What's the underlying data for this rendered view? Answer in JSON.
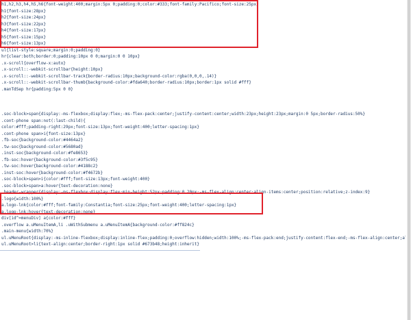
{
  "lines": [
    "h1,h2,h3,h4,h5,h6{font-weight:400;margin:5px 0;padding:0;color:#333;font-family:Pacifico;font-size:25px}",
    "h1{font-size:28px}",
    "h2{font-size:24px}",
    "h3{font-size:22px}",
    "h4{font-size:17px}",
    "h5{font-size:15px}",
    "h6{font-size:13px}",
    "ul{list-style:square;margin:0;padding:0}",
    "hr{clear:both;border:0;padding:10px 0 0;margin:0 0 10px}",
    ".x-scroll{overflow-x:auto}",
    ".x-scroll::-webkit-scrollbar{height:10px}",
    ".x-scroll::-webkit-scrollbar-track{border-radius:10px;background-color:rgba(0,0,0,.14)}",
    ".x-scroll::-webkit-scrollbar-thumb{background-color:#fda640;border-radius:10px;border:1px solid #fff}",
    ".manTdSep hr{padding:5px 0 0}",
    ".soc-block>span{display:-ms-flexbox;display:flex;-ms-flex-pack:center;justify-content:center;width:23px;height:23px;margin:0 5px;border-radius:50%}",
    ".cont-phone span:not(:last-child){",
    "color:#fff;padding-right:29px;font-size:13px;font-weight:400;letter-spacing:1px}",
    ".cont-phone span>i{font-size:13px}",
    ".fb-soc{background-color:#4464a2}",
    ".tw-soc{background-color:#5680ad}",
    ".inst-soc{background-color:#fe8653}",
    ".fb-soc:hover{background-color:#3f5c95}",
    ".tw-soc:hover{background-color:#4188c2}",
    ".inst-soc:hover{background-color:#f4672b}",
    ".soc-block>span>i{color:#fff;font-size:13px;font-weight:400}",
    ".soc-block>span>a:hover{text-decoration:none}",
    ".header-wrapper{display:-ms-flexbox;display:flex;min-height:52px;padding:0 20px;-ms-flex-align:center;align-items:center;position:relative;z-index:9}",
    ".logo{width:100%}",
    "a.logo-lnk{color:#fff;font-family:Constantia;font-size:25px;font-weight:400;letter-spacing:1px}",
    "a.logo-lnk:hover{text-decoration:none}",
    "div[id^=menuDiv] a{color:#fff}",
    ".overflow a.uMenuItemA,li .uWithSubmenu a.uMenuItemA{background-color:#ff824c}",
    ".main-menu{width:70%}",
    "ul.uMenuRoot{display:-ms-inline-flexbox;display:inline-flex;padding:0;overflow:hidden;width:100%;-ms-flex-pack:end;justify-content:flex-end;-ms-flex-align:center;align-",
    "ul.uMenuRoot>li{text-align:center;border-right:1px solid #673b48;height:inherit}"
  ]
}
